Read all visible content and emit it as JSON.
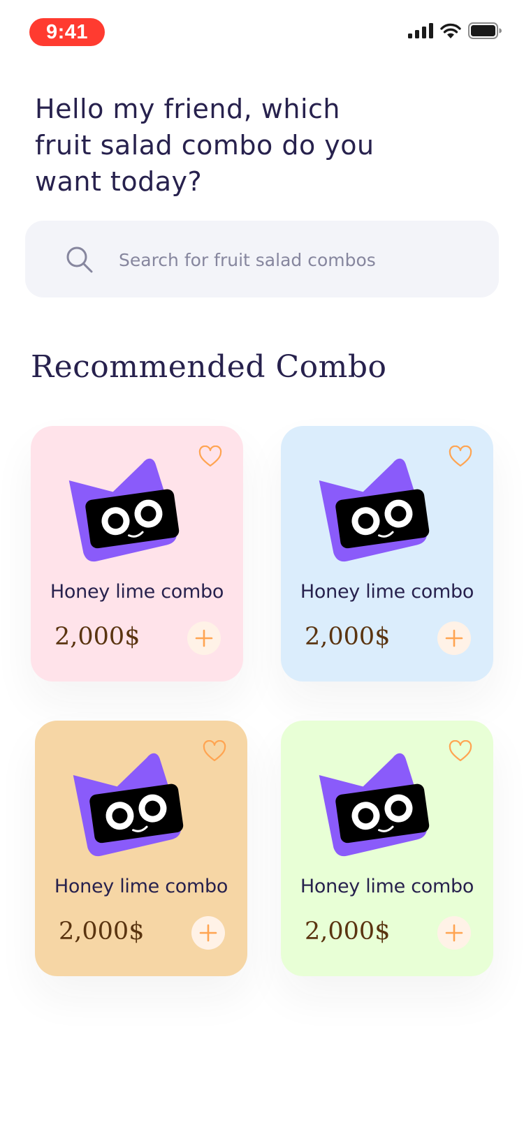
{
  "status_bar": {
    "time": "9:41",
    "icons": [
      "cellular-signal-icon",
      "wifi-icon",
      "battery-icon"
    ]
  },
  "greeting": "Hello my friend, which fruit salad combo do you want today?",
  "search": {
    "placeholder": "Search for fruit salad combos",
    "value": "",
    "icon": "search-icon"
  },
  "section": {
    "title": "Recommended Combo"
  },
  "cards": [
    {
      "name": "Honey lime combo",
      "price": "2,000$",
      "bg": "#ffe3ea",
      "icons": [
        "heart-outline-icon",
        "mascot-icon",
        "plus-icon"
      ]
    },
    {
      "name": "Honey lime combo",
      "price": "2,000$",
      "bg": "#dbedfc",
      "icons": [
        "heart-outline-icon",
        "mascot-icon",
        "plus-icon"
      ]
    },
    {
      "name": "Honey lime combo",
      "price": "2,000$",
      "bg": "#f6d6a5",
      "icons": [
        "heart-outline-icon",
        "mascot-icon",
        "plus-icon"
      ]
    },
    {
      "name": "Honey lime combo",
      "price": "2,000$",
      "bg": "#e8ffd6",
      "icons": [
        "heart-outline-icon",
        "mascot-icon",
        "plus-icon"
      ]
    }
  ],
  "colors": {
    "primary_text": "#27214d",
    "price_text": "#5a3410",
    "accent": "#ffa451",
    "add_button_bg": "#fff2e7",
    "search_bg": "#f3f4f9",
    "mascot_purple": "#8a5bfa",
    "status_pill": "#ff3b30"
  }
}
